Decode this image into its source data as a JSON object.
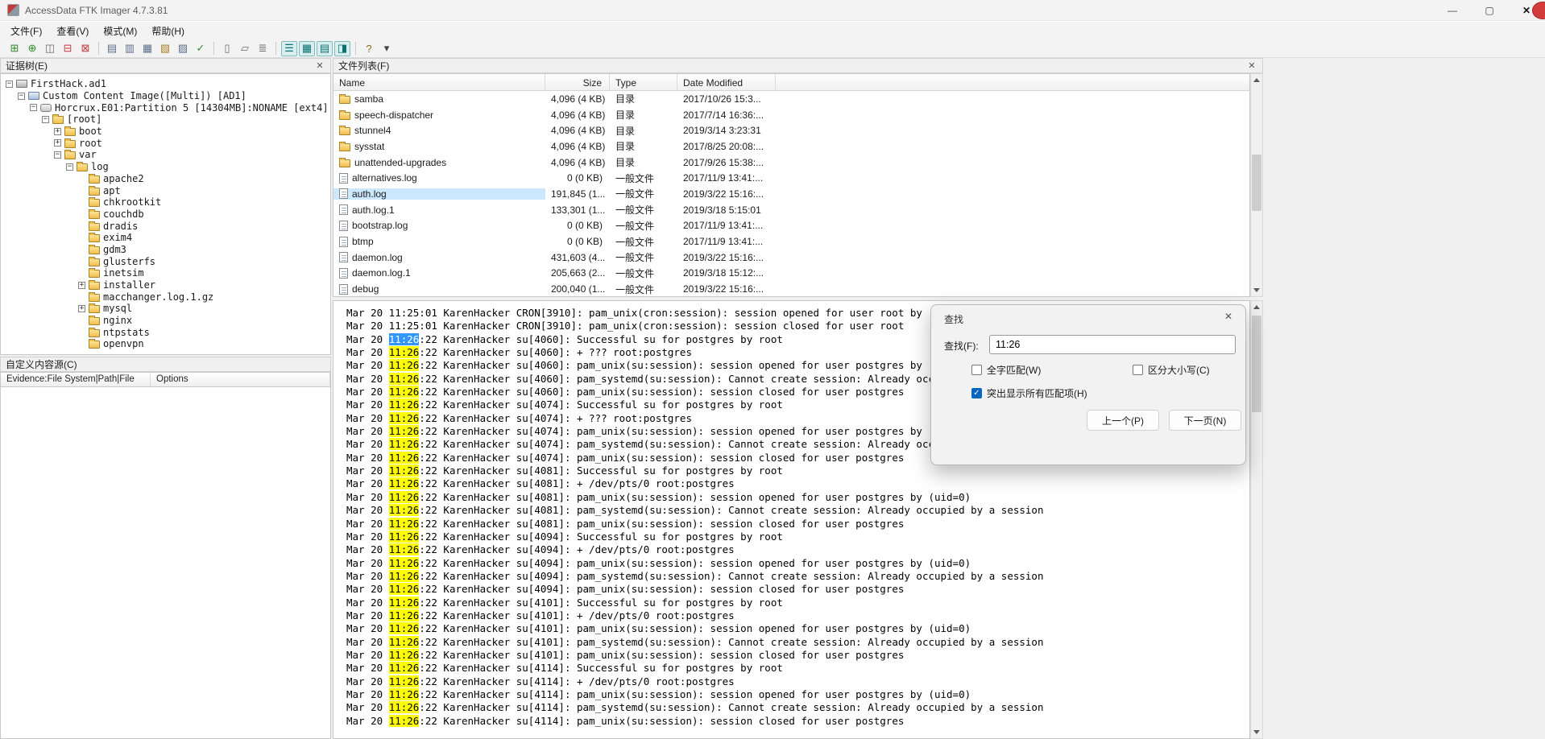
{
  "window": {
    "title": "AccessData FTK Imager 4.7.3.81",
    "controls": {
      "minimize": "—",
      "maximize": "▢",
      "close": "✕"
    }
  },
  "glyphs": {
    "close": "✕"
  },
  "menu": {
    "file": "文件(F)",
    "view": "查看(V)",
    "mode": "模式(M)",
    "help": "帮助(H)"
  },
  "toolbar": {
    "icons": [
      {
        "name": "add-evidence-item-icon",
        "glyph": "⊞",
        "color": "#2e8b2e"
      },
      {
        "name": "add-all-attached-devices-icon",
        "glyph": "⊕",
        "color": "#2e8b2e"
      },
      {
        "name": "image-mounting-icon",
        "glyph": "◫",
        "color": "#6b6b6b"
      },
      {
        "name": "remove-evidence-item-icon",
        "glyph": "⊟",
        "color": "#c23b3b"
      },
      {
        "name": "remove-all-evidence-items-icon",
        "glyph": "⊠",
        "color": "#c23b3b"
      },
      {
        "sep": true
      },
      {
        "name": "create-disk-image-icon",
        "glyph": "▤",
        "color": "#5d6f8a"
      },
      {
        "name": "export-disk-image-icon",
        "glyph": "▥",
        "color": "#5d6f8a"
      },
      {
        "name": "capture-memory-icon",
        "glyph": "▦",
        "color": "#5d6f8a"
      },
      {
        "name": "obtain-protected-files-icon",
        "glyph": "▧",
        "color": "#a8832a"
      },
      {
        "name": "detect-efs-encryption-icon",
        "glyph": "▨",
        "color": "#5d6f8a"
      },
      {
        "name": "verify-drive-image-icon",
        "glyph": "✓",
        "color": "#2e8b2e"
      },
      {
        "sep": true
      },
      {
        "name": "new-document-icon",
        "glyph": "▯",
        "color": "#6b6b6b"
      },
      {
        "name": "export-files-icon",
        "glyph": "▱",
        "color": "#6b6b6b"
      },
      {
        "name": "export-file-hash-list-icon",
        "glyph": "≣",
        "color": "#6b6b6b"
      },
      {
        "sep": true
      },
      {
        "name": "properties-view-icon",
        "glyph": "☰",
        "color": "#0a7070",
        "pressed": true
      },
      {
        "name": "hex-value-interpreter-icon",
        "glyph": "▦",
        "color": "#0a7070",
        "pressed": true
      },
      {
        "name": "custom-content-sources-icon",
        "glyph": "▤",
        "color": "#0a7070",
        "pressed": true
      },
      {
        "name": "view-pane-toggle-icon",
        "glyph": "◨",
        "color": "#0a7070",
        "pressed": true
      },
      {
        "sep": true
      },
      {
        "name": "help-key-icon",
        "glyph": "?",
        "color": "#8a6d1a"
      },
      {
        "name": "toolbar-dropdown-icon",
        "glyph": "▾",
        "color": "#444444"
      }
    ]
  },
  "panes": {
    "evidence_tree_title": "证据树(E)",
    "file_list_title": "文件列表(F)",
    "custom_content_title": "自定义内容源(C)"
  },
  "custom_content": {
    "col1": "Evidence:File System|Path|File",
    "col2": "Options"
  },
  "tree": {
    "items": [
      {
        "label": "FirstHack.ad1",
        "depth": 0,
        "exp": "-",
        "icon": "evidence"
      },
      {
        "label": "Custom Content Image([Multi]) [AD1]",
        "depth": 1,
        "exp": "-",
        "icon": "image"
      },
      {
        "label": "Horcrux.E01:Partition 5 [14304MB]:NONAME [ext4]",
        "depth": 2,
        "exp": "-",
        "icon": "partition"
      },
      {
        "label": "[root]",
        "depth": 3,
        "exp": "-",
        "icon": "folder"
      },
      {
        "label": "boot",
        "depth": 4,
        "exp": "+",
        "icon": "folder"
      },
      {
        "label": "root",
        "depth": 4,
        "exp": "+",
        "icon": "folder"
      },
      {
        "label": "var",
        "depth": 4,
        "exp": "-",
        "icon": "folder"
      },
      {
        "label": "log",
        "depth": 5,
        "exp": "-",
        "icon": "folder"
      },
      {
        "label": "apache2",
        "depth": 6,
        "exp": "",
        "icon": "folder"
      },
      {
        "label": "apt",
        "depth": 6,
        "exp": "",
        "icon": "folder"
      },
      {
        "label": "chkrootkit",
        "depth": 6,
        "exp": "",
        "icon": "folder"
      },
      {
        "label": "couchdb",
        "depth": 6,
        "exp": "",
        "icon": "folder"
      },
      {
        "label": "dradis",
        "depth": 6,
        "exp": "",
        "icon": "folder"
      },
      {
        "label": "exim4",
        "depth": 6,
        "exp": "",
        "icon": "folder"
      },
      {
        "label": "gdm3",
        "depth": 6,
        "exp": "",
        "icon": "folder"
      },
      {
        "label": "glusterfs",
        "depth": 6,
        "exp": "",
        "icon": "folder"
      },
      {
        "label": "inetsim",
        "depth": 6,
        "exp": "",
        "icon": "folder"
      },
      {
        "label": "installer",
        "depth": 6,
        "exp": "+",
        "icon": "folder"
      },
      {
        "label": "macchanger.log.1.gz",
        "depth": 6,
        "exp": "",
        "icon": "folder"
      },
      {
        "label": "mysql",
        "depth": 6,
        "exp": "+",
        "icon": "folder"
      },
      {
        "label": "nginx",
        "depth": 6,
        "exp": "",
        "icon": "folder"
      },
      {
        "label": "ntpstats",
        "depth": 6,
        "exp": "",
        "icon": "folder"
      },
      {
        "label": "openvpn",
        "depth": 6,
        "exp": "",
        "icon": "folder"
      }
    ]
  },
  "files": {
    "columns": [
      "Name",
      "Size",
      "Type",
      "Date Modified"
    ],
    "rows": [
      {
        "name": "samba",
        "size": "4,096 (4 KB)",
        "type": "目录",
        "modified": "2017/10/26 15:3...",
        "icon": "folder",
        "selected": false
      },
      {
        "name": "speech-dispatcher",
        "size": "4,096 (4 KB)",
        "type": "目录",
        "modified": "2017/7/14 16:36:...",
        "icon": "folder",
        "selected": false
      },
      {
        "name": "stunnel4",
        "size": "4,096 (4 KB)",
        "type": "目录",
        "modified": "2019/3/14 3:23:31",
        "icon": "folder",
        "selected": false
      },
      {
        "name": "sysstat",
        "size": "4,096 (4 KB)",
        "type": "目录",
        "modified": "2017/8/25 20:08:...",
        "icon": "folder",
        "selected": false
      },
      {
        "name": "unattended-upgrades",
        "size": "4,096 (4 KB)",
        "type": "目录",
        "modified": "2017/9/26 15:38:...",
        "icon": "folder",
        "selected": false
      },
      {
        "name": "alternatives.log",
        "size": "0 (0 KB)",
        "type": "一般文件",
        "modified": "2017/11/9 13:41:...",
        "icon": "file",
        "selected": false
      },
      {
        "name": "auth.log",
        "size": "191,845 (1...",
        "type": "一般文件",
        "modified": "2019/3/22 15:16:...",
        "icon": "file",
        "selected": true
      },
      {
        "name": "auth.log.1",
        "size": "133,301 (1...",
        "type": "一般文件",
        "modified": "2019/3/18 5:15:01",
        "icon": "file",
        "selected": false
      },
      {
        "name": "bootstrap.log",
        "size": "0 (0 KB)",
        "type": "一般文件",
        "modified": "2017/11/9 13:41:...",
        "icon": "file",
        "selected": false
      },
      {
        "name": "btmp",
        "size": "0 (0 KB)",
        "type": "一般文件",
        "modified": "2017/11/9 13:41:...",
        "icon": "file",
        "selected": false
      },
      {
        "name": "daemon.log",
        "size": "431,603 (4...",
        "type": "一般文件",
        "modified": "2019/3/22 15:16:...",
        "icon": "file",
        "selected": false
      },
      {
        "name": "daemon.log.1",
        "size": "205,663 (2...",
        "type": "一般文件",
        "modified": "2019/3/18 15:12:...",
        "icon": "file",
        "selected": false
      },
      {
        "name": "debug",
        "size": "200,040 (1...",
        "type": "一般文件",
        "modified": "2019/3/22 15:16:...",
        "icon": "file",
        "selected": false
      }
    ]
  },
  "log": {
    "search_term": "11:26",
    "current_match": 0,
    "highlight_color": "#ffff00",
    "current_match_color": "#3297fd",
    "lines": [
      "Mar 20 11:25:01 KarenHacker CRON[3910]: pam_unix(cron:session): session opened for user root by (uid=0)",
      "Mar 20 11:25:01 KarenHacker CRON[3910]: pam_unix(cron:session): session closed for user root",
      "Mar 20 11:26:22 KarenHacker su[4060]: Successful su for postgres by root",
      "Mar 20 11:26:22 KarenHacker su[4060]: + ??? root:postgres",
      "Mar 20 11:26:22 KarenHacker su[4060]: pam_unix(su:session): session opened for user postgres by (uid=0)",
      "Mar 20 11:26:22 KarenHacker su[4060]: pam_systemd(su:session): Cannot create session: Already occupied by a session",
      "Mar 20 11:26:22 KarenHacker su[4060]: pam_unix(su:session): session closed for user postgres",
      "Mar 20 11:26:22 KarenHacker su[4074]: Successful su for postgres by root",
      "Mar 20 11:26:22 KarenHacker su[4074]: + ??? root:postgres",
      "Mar 20 11:26:22 KarenHacker su[4074]: pam_unix(su:session): session opened for user postgres by (uid=0)",
      "Mar 20 11:26:22 KarenHacker su[4074]: pam_systemd(su:session): Cannot create session: Already occupied by a session",
      "Mar 20 11:26:22 KarenHacker su[4074]: pam_unix(su:session): session closed for user postgres",
      "Mar 20 11:26:22 KarenHacker su[4081]: Successful su for postgres by root",
      "Mar 20 11:26:22 KarenHacker su[4081]: + /dev/pts/0 root:postgres",
      "Mar 20 11:26:22 KarenHacker su[4081]: pam_unix(su:session): session opened for user postgres by (uid=0)",
      "Mar 20 11:26:22 KarenHacker su[4081]: pam_systemd(su:session): Cannot create session: Already occupied by a session",
      "Mar 20 11:26:22 KarenHacker su[4081]: pam_unix(su:session): session closed for user postgres",
      "Mar 20 11:26:22 KarenHacker su[4094]: Successful su for postgres by root",
      "Mar 20 11:26:22 KarenHacker su[4094]: + /dev/pts/0 root:postgres",
      "Mar 20 11:26:22 KarenHacker su[4094]: pam_unix(su:session): session opened for user postgres by (uid=0)",
      "Mar 20 11:26:22 KarenHacker su[4094]: pam_systemd(su:session): Cannot create session: Already occupied by a session",
      "Mar 20 11:26:22 KarenHacker su[4094]: pam_unix(su:session): session closed for user postgres",
      "Mar 20 11:26:22 KarenHacker su[4101]: Successful su for postgres by root",
      "Mar 20 11:26:22 KarenHacker su[4101]: + /dev/pts/0 root:postgres",
      "Mar 20 11:26:22 KarenHacker su[4101]: pam_unix(su:session): session opened for user postgres by (uid=0)",
      "Mar 20 11:26:22 KarenHacker su[4101]: pam_systemd(su:session): Cannot create session: Already occupied by a session",
      "Mar 20 11:26:22 KarenHacker su[4101]: pam_unix(su:session): session closed for user postgres",
      "Mar 20 11:26:22 KarenHacker su[4114]: Successful su for postgres by root",
      "Mar 20 11:26:22 KarenHacker su[4114]: + /dev/pts/0 root:postgres",
      "Mar 20 11:26:22 KarenHacker su[4114]: pam_unix(su:session): session opened for user postgres by (uid=0)",
      "Mar 20 11:26:22 KarenHacker su[4114]: pam_systemd(su:session): Cannot create session: Already occupied by a session",
      "Mar 20 11:26:22 KarenHacker su[4114]: pam_unix(su:session): session closed for user postgres"
    ]
  },
  "find": {
    "title": "查找",
    "label": "查找(F):",
    "value": "11:26",
    "check_whole": {
      "label": "全字匹配(W)",
      "checked": false
    },
    "check_case": {
      "label": "区分大小写(C)",
      "checked": false
    },
    "check_highlight": {
      "label": "突出显示所有匹配项(H)",
      "checked": true
    },
    "prev_button": "上一个(P)",
    "next_button": "下一页(N)"
  }
}
